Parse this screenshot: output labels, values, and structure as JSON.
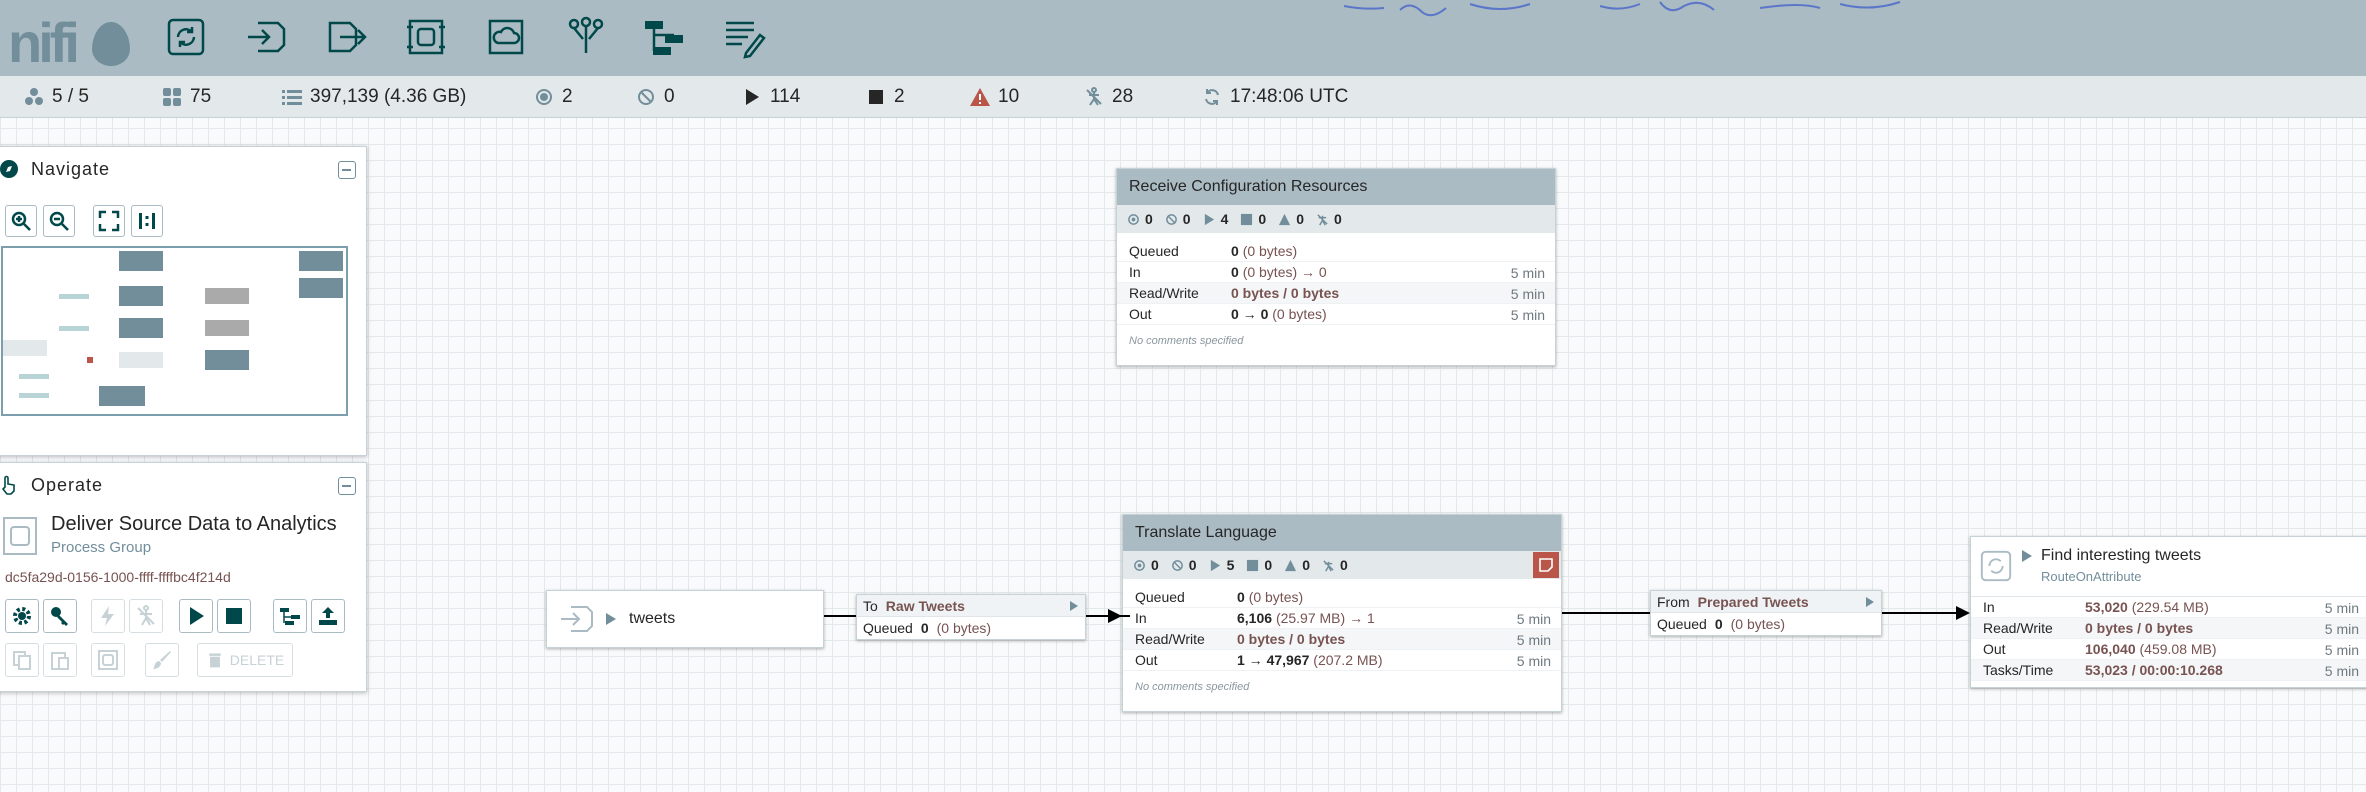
{
  "header": {
    "logo": "nifi",
    "toolbar": [
      "processor-icon",
      "input-port-icon",
      "output-port-icon",
      "process-group-icon",
      "remote-process-group-icon",
      "funnel-icon",
      "template-icon",
      "label-icon"
    ]
  },
  "status": {
    "cluster": "5 / 5",
    "threads": "75",
    "queued": "397,139 (4.36 GB)",
    "transmitting": "2",
    "not_transmitting": "0",
    "running": "114",
    "stopped": "2",
    "invalid": "10",
    "disabled": "28",
    "refreshed": "17:48:06 UTC"
  },
  "navigate": {
    "title": "Navigate"
  },
  "operate": {
    "title": "Operate",
    "name": "Deliver Source Data to Analytics",
    "type": "Process Group",
    "id": "dc5fa29d-0156-1000-ffff-ffffbc4f214d",
    "delete_label": "DELETE"
  },
  "groups": [
    {
      "name": "Receive Configuration Resources",
      "stats": {
        "transmitting": "0",
        "not_transmitting": "0",
        "running": "4",
        "stopped": "0",
        "invalid": "0",
        "disabled": "0"
      },
      "rows": [
        {
          "label": "Queued",
          "v": "0",
          "detail": "(0 bytes)",
          "time": ""
        },
        {
          "label": "In",
          "v": "0",
          "detail": "(0 bytes) → 0",
          "time": "5 min"
        },
        {
          "label": "Read/Write",
          "v": "0 bytes / 0 bytes",
          "detail": "",
          "time": "5 min"
        },
        {
          "label": "Out",
          "v": "0 → 0",
          "detail": "(0 bytes)",
          "time": "5 min"
        }
      ],
      "comment": "No comments specified"
    },
    {
      "name": "Translate Language",
      "stats": {
        "transmitting": "0",
        "not_transmitting": "0",
        "running": "5",
        "stopped": "0",
        "invalid": "0",
        "disabled": "0"
      },
      "rows": [
        {
          "label": "Queued",
          "v": "0",
          "detail": "(0 bytes)",
          "time": ""
        },
        {
          "label": "In",
          "v": "6,106",
          "detail": "(25.97 MB) → 1",
          "time": "5 min"
        },
        {
          "label": "Read/Write",
          "v": "0 bytes / 0 bytes",
          "detail": "",
          "time": "5 min"
        },
        {
          "label": "Out",
          "v": "1 → 47,967",
          "detail": "(207.2 MB)",
          "time": "5 min"
        }
      ],
      "comment": "No comments specified"
    }
  ],
  "input_port": {
    "name": "tweets"
  },
  "connections": [
    {
      "dir": "To",
      "name": "Raw Tweets",
      "queued_label": "Queued",
      "queued": "0",
      "bytes": "(0 bytes)"
    },
    {
      "dir": "From",
      "name": "Prepared Tweets",
      "queued_label": "Queued",
      "queued": "0",
      "bytes": "(0 bytes)"
    }
  ],
  "processor": {
    "name": "Find interesting tweets",
    "type": "RouteOnAttribute",
    "rows": [
      {
        "label": "In",
        "v": "53,020",
        "detail": "(229.54 MB)",
        "time": "5 min"
      },
      {
        "label": "Read/Write",
        "v": "0 bytes / 0 bytes",
        "detail": "",
        "time": "5 min"
      },
      {
        "label": "Out",
        "v": "106,040",
        "detail": "(459.08 MB)",
        "time": "5 min"
      },
      {
        "label": "Tasks/Time",
        "v": "53,023 / 00:00:10.268",
        "detail": "",
        "time": "5 min"
      }
    ]
  },
  "colors": {
    "header": "#aabbc3",
    "accent": "#728e9b",
    "invalid": "#ba554a",
    "value": "#775351"
  }
}
